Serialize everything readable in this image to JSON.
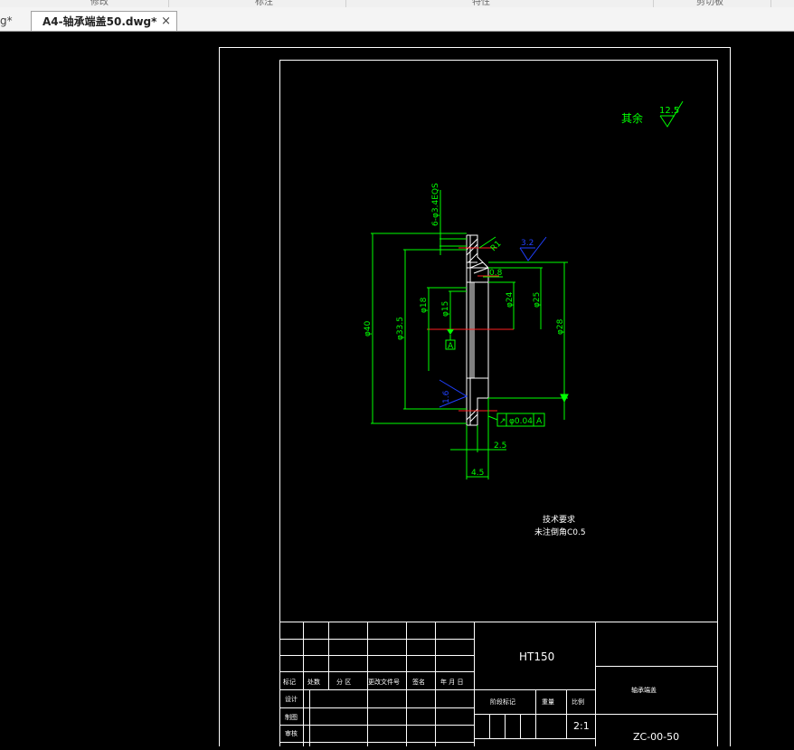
{
  "ribbon": {
    "groups": [
      "修改",
      "标注",
      "特性",
      "剪切板"
    ]
  },
  "tabs": [
    {
      "label": "g*"
    },
    {
      "label": "A4-轴承端盖50.dwg*",
      "close": "×"
    }
  ],
  "drawing": {
    "roughness_other_label": "其余",
    "roughness_other_value": "12.5",
    "roughness_top": "3.2",
    "roughness_bottom": "1.6",
    "dims": {
      "d40": "φ40",
      "d33_5": "φ33.5",
      "d18": "φ18",
      "d15": "φ15",
      "d24": "φ24",
      "d25": "φ25",
      "d28": "φ28",
      "holes": "6-φ3.4EQS",
      "r1": "R1",
      "c08": "0.8",
      "t25": "2.5",
      "t45": "4.5"
    },
    "datum": "A",
    "tolerance": {
      "symbol": "↗",
      "value": "φ0.04",
      "datum": "A"
    },
    "notes_title": "技术要求",
    "notes_line": "未注倒角C0.5"
  },
  "title_block": {
    "header": [
      "标记",
      "处数",
      "分 区",
      "更改文件号",
      "签名",
      "年 月 日"
    ],
    "rows": [
      "设计",
      "制图",
      "审核"
    ],
    "material": "HT150",
    "stage_label": "阶段标记",
    "weight_label": "重量",
    "scale_label": "比例",
    "scale": "2:1",
    "part_name": "轴承端盖",
    "part_number": "ZC-00-50"
  }
}
